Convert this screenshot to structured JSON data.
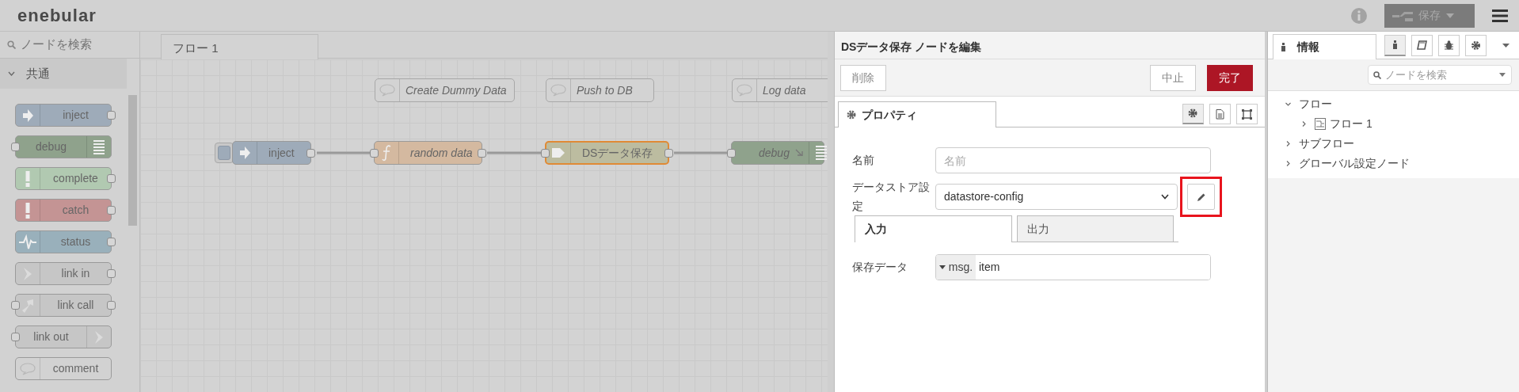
{
  "header": {
    "logo": "enebular",
    "save_button": "保存"
  },
  "palette": {
    "search": {
      "placeholder": "ノードを検索"
    },
    "category": {
      "label": "共通",
      "expanded": true
    },
    "nodes": [
      {
        "label": "inject",
        "kind": "inject",
        "color": "#9eabb9"
      },
      {
        "label": "debug",
        "kind": "debug",
        "color": "#8fa28c"
      },
      {
        "label": "complete",
        "kind": "complete",
        "color": "#b1c9b1"
      },
      {
        "label": "catch",
        "kind": "catch",
        "color": "#c49494"
      },
      {
        "label": "status",
        "kind": "status",
        "color": "#99b0bb"
      },
      {
        "label": "link in",
        "kind": "link-in",
        "color": "#c6c6c6"
      },
      {
        "label": "link call",
        "kind": "link-call",
        "color": "#c6c6c6"
      },
      {
        "label": "link out",
        "kind": "link-out",
        "color": "#c6c6c6"
      },
      {
        "label": "comment",
        "kind": "comment",
        "color": "#d2d2d2"
      }
    ]
  },
  "workspace": {
    "tabs": [
      {
        "label": "フロー 1",
        "selected": true
      }
    ],
    "comments": [
      {
        "label": "Create Dummy Data"
      },
      {
        "label": "Push to DB"
      },
      {
        "label": "Log data"
      }
    ],
    "nodes": [
      {
        "label": "inject",
        "kind": "inject",
        "color": "#9eabb9",
        "selected": false,
        "custom_label": false,
        "wire_out": true
      },
      {
        "label": "random data",
        "kind": "function",
        "color": "#d4b9a0",
        "selected": false,
        "custom_label": true,
        "wire_out": true
      },
      {
        "label": "DSデータ保存",
        "kind": "datastore",
        "color": "#bcbca0",
        "selected": true,
        "custom_label": false,
        "wire_out": true
      },
      {
        "label": "debug",
        "kind": "debug",
        "color": "#8fa28c",
        "selected": false,
        "custom_label": true,
        "wire_out": false
      }
    ]
  },
  "editor": {
    "title": "DSデータ保存 ノードを編集",
    "delete_button": "削除",
    "cancel_button": "中止",
    "done_button": "完了",
    "tabs": [
      {
        "label": "プロパティ",
        "selected": true
      }
    ],
    "view_buttons": [
      {
        "kind": "properties",
        "selected": true
      },
      {
        "kind": "description",
        "selected": false
      },
      {
        "kind": "appearance",
        "selected": false
      }
    ],
    "name_field": {
      "label": "名前",
      "placeholder": "名前"
    },
    "datastore_field": {
      "label": "データストア設定",
      "value": "datastore-config",
      "highlighted": true
    },
    "subtabs": [
      {
        "label": "入力",
        "selected": true
      },
      {
        "label": "出力",
        "selected": false
      }
    ],
    "save_data_field": {
      "label": "保存データ",
      "type": "msg.",
      "value": "item"
    }
  },
  "sidebar": {
    "tabs": [
      {
        "label": "情報",
        "selected": true
      }
    ],
    "tool_buttons": [
      {
        "kind": "info",
        "selected": true
      },
      {
        "kind": "book",
        "selected": false
      },
      {
        "kind": "bug",
        "selected": false
      },
      {
        "kind": "settings",
        "selected": false
      }
    ],
    "search": {
      "placeholder": "ノードを検索"
    },
    "tree": [
      {
        "label": "フロー",
        "expanded": true,
        "children": [
          {
            "label": "フロー 1",
            "kind": "flow",
            "expanded": false
          }
        ]
      },
      {
        "label": "サブフロー",
        "expanded": false
      },
      {
        "label": "グローバル設定ノード",
        "expanded": false
      }
    ]
  }
}
